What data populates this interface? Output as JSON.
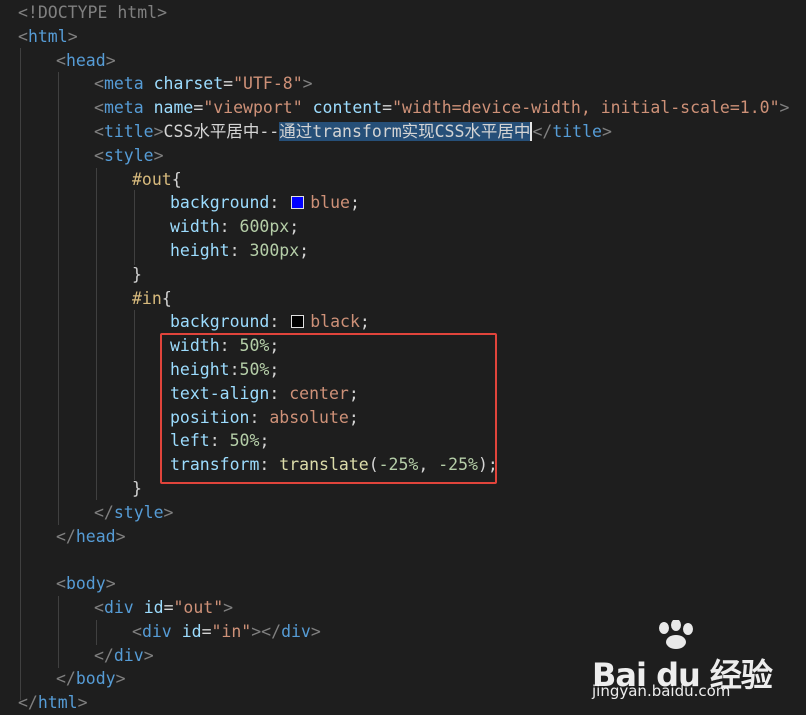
{
  "editor": {
    "lines": [
      [
        {
          "t": "<!DOCTYPE html>",
          "c": "t-punc"
        }
      ],
      [
        {
          "t": "<",
          "c": "t-punc"
        },
        {
          "t": "html",
          "c": "t-tag"
        },
        {
          "t": ">",
          "c": "t-punc"
        }
      ],
      [
        {
          "t": "<",
          "c": "t-punc"
        },
        {
          "t": "head",
          "c": "t-tag"
        },
        {
          "t": ">",
          "c": "t-punc"
        }
      ],
      [
        {
          "t": "<",
          "c": "t-punc"
        },
        {
          "t": "meta",
          "c": "t-tag"
        },
        {
          "t": " ",
          "c": "t-text"
        },
        {
          "t": "charset",
          "c": "t-attr"
        },
        {
          "t": "=",
          "c": "t-text"
        },
        {
          "t": "\"UTF-8\"",
          "c": "t-str"
        },
        {
          "t": ">",
          "c": "t-punc"
        }
      ],
      [
        {
          "t": "<",
          "c": "t-punc"
        },
        {
          "t": "meta",
          "c": "t-tag"
        },
        {
          "t": " ",
          "c": "t-text"
        },
        {
          "t": "name",
          "c": "t-attr"
        },
        {
          "t": "=",
          "c": "t-text"
        },
        {
          "t": "\"viewport\"",
          "c": "t-str"
        },
        {
          "t": " ",
          "c": "t-text"
        },
        {
          "t": "content",
          "c": "t-attr"
        },
        {
          "t": "=",
          "c": "t-text"
        },
        {
          "t": "\"width=device-width, initial-scale=1.0\"",
          "c": "t-str"
        },
        {
          "t": ">",
          "c": "t-punc"
        }
      ],
      [
        {
          "t": "<",
          "c": "t-punc"
        },
        {
          "t": "title",
          "c": "t-tag"
        },
        {
          "t": ">",
          "c": "t-punc"
        },
        {
          "t": "CSS水平居中--",
          "c": "t-text"
        },
        {
          "t": "通过transform实现CSS水平居中",
          "c": "t-text",
          "sel": true
        },
        {
          "cursor": true
        },
        {
          "t": "</",
          "c": "t-punc"
        },
        {
          "t": "title",
          "c": "t-tag"
        },
        {
          "t": ">",
          "c": "t-punc"
        }
      ],
      [
        {
          "t": "<",
          "c": "t-punc"
        },
        {
          "t": "style",
          "c": "t-tag"
        },
        {
          "t": ">",
          "c": "t-punc"
        }
      ],
      [
        {
          "t": "#out",
          "c": "t-sel"
        },
        {
          "t": "{",
          "c": "t-text"
        }
      ],
      [
        {
          "t": "background",
          "c": "t-prop"
        },
        {
          "t": ": ",
          "c": "t-text"
        },
        {
          "swatch": "#0000ff"
        },
        {
          "t": "blue",
          "c": "t-val"
        },
        {
          "t": ";",
          "c": "t-text"
        }
      ],
      [
        {
          "t": "width",
          "c": "t-prop"
        },
        {
          "t": ": ",
          "c": "t-text"
        },
        {
          "t": "600px",
          "c": "t-num"
        },
        {
          "t": ";",
          "c": "t-text"
        }
      ],
      [
        {
          "t": "height",
          "c": "t-prop"
        },
        {
          "t": ": ",
          "c": "t-text"
        },
        {
          "t": "300px",
          "c": "t-num"
        },
        {
          "t": ";",
          "c": "t-text"
        }
      ],
      [
        {
          "t": "}",
          "c": "t-text"
        }
      ],
      [
        {
          "t": "#in",
          "c": "t-sel"
        },
        {
          "t": "{",
          "c": "t-text"
        }
      ],
      [
        {
          "t": "background",
          "c": "t-prop"
        },
        {
          "t": ": ",
          "c": "t-text"
        },
        {
          "swatch": "#000000"
        },
        {
          "t": "black",
          "c": "t-val"
        },
        {
          "t": ";",
          "c": "t-text"
        }
      ],
      [
        {
          "t": "width",
          "c": "t-prop"
        },
        {
          "t": ": ",
          "c": "t-text"
        },
        {
          "t": "50%",
          "c": "t-num"
        },
        {
          "t": ";",
          "c": "t-text"
        }
      ],
      [
        {
          "t": "height",
          "c": "t-prop"
        },
        {
          "t": ":",
          "c": "t-text"
        },
        {
          "t": "50%",
          "c": "t-num"
        },
        {
          "t": ";",
          "c": "t-text"
        }
      ],
      [
        {
          "t": "text-align",
          "c": "t-prop"
        },
        {
          "t": ": ",
          "c": "t-text"
        },
        {
          "t": "center",
          "c": "t-val"
        },
        {
          "t": ";",
          "c": "t-text"
        }
      ],
      [
        {
          "t": "position",
          "c": "t-prop"
        },
        {
          "t": ": ",
          "c": "t-text"
        },
        {
          "t": "absolute",
          "c": "t-val"
        },
        {
          "t": ";",
          "c": "t-text"
        }
      ],
      [
        {
          "t": "left",
          "c": "t-prop"
        },
        {
          "t": ": ",
          "c": "t-text"
        },
        {
          "t": "50%",
          "c": "t-num"
        },
        {
          "t": ";",
          "c": "t-text"
        }
      ],
      [
        {
          "t": "transform",
          "c": "t-prop"
        },
        {
          "t": ": ",
          "c": "t-text"
        },
        {
          "t": "translate",
          "c": "t-fn"
        },
        {
          "t": "(",
          "c": "t-text"
        },
        {
          "t": "-25%",
          "c": "t-num"
        },
        {
          "t": ", ",
          "c": "t-text"
        },
        {
          "t": "-25%",
          "c": "t-num"
        },
        {
          "t": ");",
          "c": "t-text"
        }
      ],
      [
        {
          "t": "}",
          "c": "t-text"
        }
      ],
      [
        {
          "t": "</",
          "c": "t-punc"
        },
        {
          "t": "style",
          "c": "t-tag"
        },
        {
          "t": ">",
          "c": "t-punc"
        }
      ],
      [
        {
          "t": "</",
          "c": "t-punc"
        },
        {
          "t": "head",
          "c": "t-tag"
        },
        {
          "t": ">",
          "c": "t-punc"
        }
      ],
      [],
      [
        {
          "t": "<",
          "c": "t-punc"
        },
        {
          "t": "body",
          "c": "t-tag"
        },
        {
          "t": ">",
          "c": "t-punc"
        }
      ],
      [
        {
          "t": "<",
          "c": "t-punc"
        },
        {
          "t": "div",
          "c": "t-tag"
        },
        {
          "t": " ",
          "c": "t-text"
        },
        {
          "t": "id",
          "c": "t-attr"
        },
        {
          "t": "=",
          "c": "t-text"
        },
        {
          "t": "\"out\"",
          "c": "t-str"
        },
        {
          "t": ">",
          "c": "t-punc"
        }
      ],
      [
        {
          "t": "<",
          "c": "t-punc"
        },
        {
          "t": "div",
          "c": "t-tag"
        },
        {
          "t": " ",
          "c": "t-text"
        },
        {
          "t": "id",
          "c": "t-attr"
        },
        {
          "t": "=",
          "c": "t-text"
        },
        {
          "t": "\"in\"",
          "c": "t-str"
        },
        {
          "t": "></",
          "c": "t-punc"
        },
        {
          "t": "div",
          "c": "t-tag"
        },
        {
          "t": ">",
          "c": "t-punc"
        }
      ],
      [
        {
          "t": "</",
          "c": "t-punc"
        },
        {
          "t": "div",
          "c": "t-tag"
        },
        {
          "t": ">",
          "c": "t-punc"
        }
      ],
      [
        {
          "t": "</",
          "c": "t-punc"
        },
        {
          "t": "body",
          "c": "t-tag"
        },
        {
          "t": ">",
          "c": "t-punc"
        }
      ],
      [
        {
          "t": "</",
          "c": "t-punc"
        },
        {
          "t": "html",
          "c": "t-tag"
        },
        {
          "t": ">",
          "c": "t-punc"
        }
      ]
    ]
  },
  "watermark": {
    "brand": "Bai du 经验",
    "url": "jingyan.baidu.com"
  }
}
